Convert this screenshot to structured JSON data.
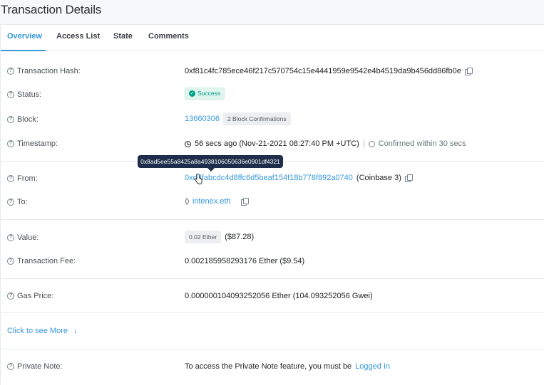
{
  "page": {
    "title": "Transaction Details"
  },
  "tabs": [
    {
      "label": "Overview",
      "active": true
    },
    {
      "label": "Access List",
      "active": false
    },
    {
      "label": "State",
      "active": false
    },
    {
      "label": "Comments",
      "active": false
    }
  ],
  "rows": {
    "tx_hash": {
      "label": "Transaction Hash:",
      "value": "0xf81c4fc785ece46f217c570754c15e4441959e9542e4b4519da9b456dd86fb0e"
    },
    "status": {
      "label": "Status:",
      "value": "Success"
    },
    "block": {
      "label": "Block:",
      "value": "13660306",
      "confirmations": "2 Block Confirmations"
    },
    "timestamp": {
      "label": "Timestamp:",
      "value": "56 secs ago (Nov-21-2021 08:27:40 PM +UTC)",
      "separator": "|",
      "confirmed": "Confirmed within 30 secs"
    },
    "from": {
      "label": "From:",
      "value": "0xddfabcdc4d8ffc6d5beaf154f18b778f892a0740",
      "tag": "(Coinbase 3)"
    },
    "to": {
      "label": "To:",
      "value": "intenex.eth",
      "tooltip": "0x8ad5ee55a8425a8a4938106050636e0901df4321"
    },
    "value": {
      "label": "Value:",
      "amount": "0.02 Ether",
      "usd": "($87.28)"
    },
    "fee": {
      "label": "Transaction Fee:",
      "value": "0.002185958293176 Ether ($9.54)"
    },
    "gas_price": {
      "label": "Gas Price:",
      "value": "0.000000104093252056 Ether (104.093252056 Gwei)"
    },
    "private_note": {
      "label": "Private Note:",
      "text": "To access the Private Note feature, you must be",
      "link": "Logged In"
    }
  },
  "see_more": {
    "label": "Click to see More",
    "arrow": "↓"
  },
  "help_glyph": "?",
  "icons": {
    "check": "✓",
    "code": "⟨⟩"
  },
  "colors": {
    "link": "#3498db",
    "success": "#00a186",
    "tooltip_bg": "#1e2d4a"
  }
}
